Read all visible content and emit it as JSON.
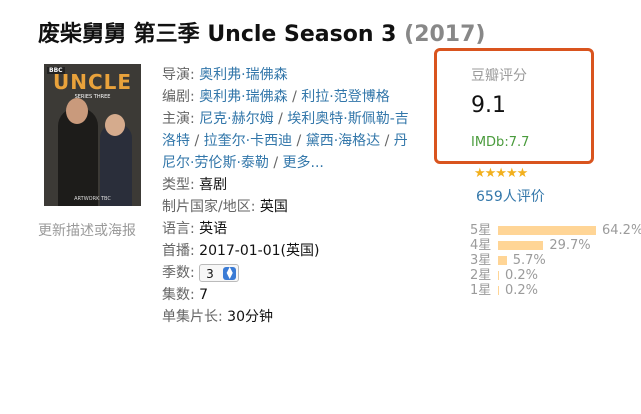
{
  "title": {
    "main": "废柴舅舅 第三季 Uncle Season 3",
    "year": "(2017)"
  },
  "poster": {
    "bbc": "BBC",
    "logo": "UNCLE",
    "series": "SERIES THREE",
    "artwork": "ARTWORK TBC"
  },
  "poster_hint": "更新描述或海报",
  "info": {
    "director_label": "导演:",
    "director": "奥利弗·瑞佛森",
    "writer_label": "编剧:",
    "writer1": "奥利弗·瑞佛森",
    "writer_sep": " / ",
    "writer2": "利拉·范登博格",
    "cast_label": "主演:",
    "cast1": "尼克·赫尔姆",
    "cast2": "埃利奥特·斯佩勒-吉洛特",
    "cast3": "拉奎尔·卡西迪",
    "cast4": "黛西·海格达",
    "cast5": "丹尼尔·劳伦斯·泰勒",
    "cast_sep": " / ",
    "cast_more": "更多...",
    "genre_label": "类型:",
    "genre": "喜剧",
    "country_label": "制片国家/地区:",
    "country": "英国",
    "language_label": "语言:",
    "language": "英语",
    "premiere_label": "首播:",
    "premiere": "2017-01-01(英国)",
    "season_label": "季数:",
    "season": "3",
    "episodes_label": "集数:",
    "episodes": "7",
    "runtime_label": "单集片长:",
    "runtime": "30分钟"
  },
  "rating": {
    "label": "豆瓣评分",
    "score": "9.1",
    "imdb": "IMDb:7.7",
    "stars": "★★★★★",
    "stars_value": 4.5,
    "count": "659人评价",
    "dist": [
      {
        "star": "5星",
        "pct": "64.2%",
        "value": 64.2
      },
      {
        "star": "4星",
        "pct": "29.7%",
        "value": 29.7
      },
      {
        "star": "3星",
        "pct": "5.7%",
        "value": 5.7
      },
      {
        "star": "2星",
        "pct": "0.2%",
        "value": 0.2
      },
      {
        "star": "1星",
        "pct": "0.2%",
        "value": 0.2
      }
    ]
  },
  "colors": {
    "accent_box": "#d9541e",
    "link": "#3377aa",
    "bar": "#ffd596",
    "imdb": "#4a9b3c"
  }
}
